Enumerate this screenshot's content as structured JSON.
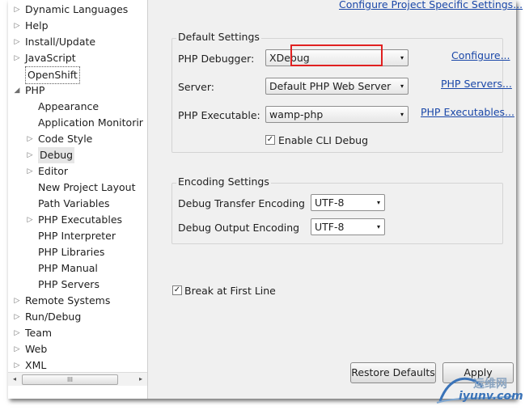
{
  "tree": {
    "items": [
      {
        "label": "Dynamic Languages",
        "arrow": "▷"
      },
      {
        "label": "Help",
        "arrow": "▷"
      },
      {
        "label": "Install/Update",
        "arrow": "▷"
      },
      {
        "label": "JavaScript",
        "arrow": "▷"
      },
      {
        "label": "OpenShift",
        "arrow": ""
      },
      {
        "label": "PHP",
        "arrow": "◢"
      },
      {
        "label": "Appearance",
        "arrow": ""
      },
      {
        "label": "Application Monitorir",
        "arrow": ""
      },
      {
        "label": "Code Style",
        "arrow": "▷"
      },
      {
        "label": "Debug",
        "arrow": "▷"
      },
      {
        "label": "Editor",
        "arrow": "▷"
      },
      {
        "label": "New Project Layout",
        "arrow": ""
      },
      {
        "label": "Path Variables",
        "arrow": ""
      },
      {
        "label": "PHP Executables",
        "arrow": "▷"
      },
      {
        "label": "PHP Interpreter",
        "arrow": ""
      },
      {
        "label": "PHP Libraries",
        "arrow": ""
      },
      {
        "label": "PHP Manual",
        "arrow": ""
      },
      {
        "label": "PHP Servers",
        "arrow": ""
      },
      {
        "label": "Remote Systems",
        "arrow": "▷"
      },
      {
        "label": "Run/Debug",
        "arrow": "▷"
      },
      {
        "label": "Team",
        "arrow": "▷"
      },
      {
        "label": "Web",
        "arrow": "▷"
      },
      {
        "label": "XML",
        "arrow": "▷"
      }
    ],
    "scroll_left": "◂",
    "scroll_right": "▸",
    "scroll_grip": "III"
  },
  "content": {
    "top_link": "Configure Project Specific Settings...",
    "default_settings": {
      "title": "Default Settings",
      "php_debugger_label": "PHP Debugger:",
      "php_debugger_value": "XDebug",
      "configure_link": "Configure...",
      "server_label": "Server:",
      "server_value": "Default PHP Web Server",
      "php_servers_link": "PHP Servers...",
      "php_executable_label": "PHP Executable:",
      "php_executable_value": "wamp-php",
      "php_executables_link": "PHP Executables...",
      "enable_cli_debug_label": "Enable CLI Debug",
      "enable_cli_debug_checked": true
    },
    "encoding_settings": {
      "title": "Encoding Settings",
      "transfer_label": "Debug Transfer Encoding",
      "transfer_value": "UTF-8",
      "output_label": "Debug Output Encoding",
      "output_value": "UTF-8"
    },
    "break_first_line_label": "Break at First Line",
    "break_first_line_checked": true,
    "restore_defaults_label": "Restore Defaults",
    "apply_label": "Apply",
    "dropdown_glyph": "▾",
    "check_glyph": "✓"
  },
  "watermark": {
    "line1": "运维网",
    "line2": "iyunv.com"
  },
  "colors": {
    "link": "#1a47a8",
    "highlight_box": "#e02020",
    "panel_bg": "#f0f0f0"
  }
}
